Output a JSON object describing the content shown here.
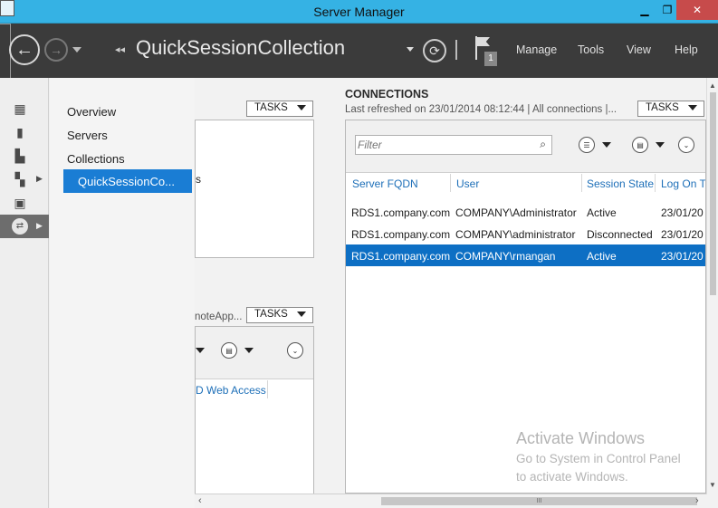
{
  "window": {
    "title": "Server Manager",
    "minimize": "▁",
    "restore": "❐",
    "close": "✕"
  },
  "header": {
    "breadcrumb_arrows": "◂◂",
    "breadcrumb": "QuickSessionCollection",
    "refresh_icon": "refresh-icon",
    "flag_badge": "1",
    "menu": [
      "Manage",
      "Tools",
      "View",
      "Help"
    ]
  },
  "nav": {
    "items": [
      "Overview",
      "Servers",
      "Collections"
    ],
    "selected": "QuickSessionCo..."
  },
  "left_panel": {
    "tasks_label": "TASKS",
    "partial_text_1": "s",
    "partial_text_2": "noteApp...",
    "partial_column": "D Web Access"
  },
  "connections": {
    "title": "CONNECTIONS",
    "subtitle": "Last refreshed on 23/01/2014 08:12:44 | All connections  |...",
    "tasks_label": "TASKS",
    "filter_placeholder": "Filter",
    "columns": [
      "Server FQDN",
      "User",
      "Session State",
      "Log On T"
    ],
    "rows": [
      [
        "RDS1.company.com",
        "COMPANY\\Administrator",
        "Active",
        "23/01/20"
      ],
      [
        "RDS1.company.com",
        "COMPANY\\administrator",
        "Disconnected",
        "23/01/20"
      ],
      [
        "RDS1.company.com",
        "COMPANY\\rmangan",
        "Active",
        "23/01/20"
      ]
    ],
    "selected_row": 2
  },
  "watermark": {
    "line1": "Activate Windows",
    "line2": "Go to System in Control Panel",
    "line3": "to activate Windows."
  },
  "scroll_grip": "III"
}
